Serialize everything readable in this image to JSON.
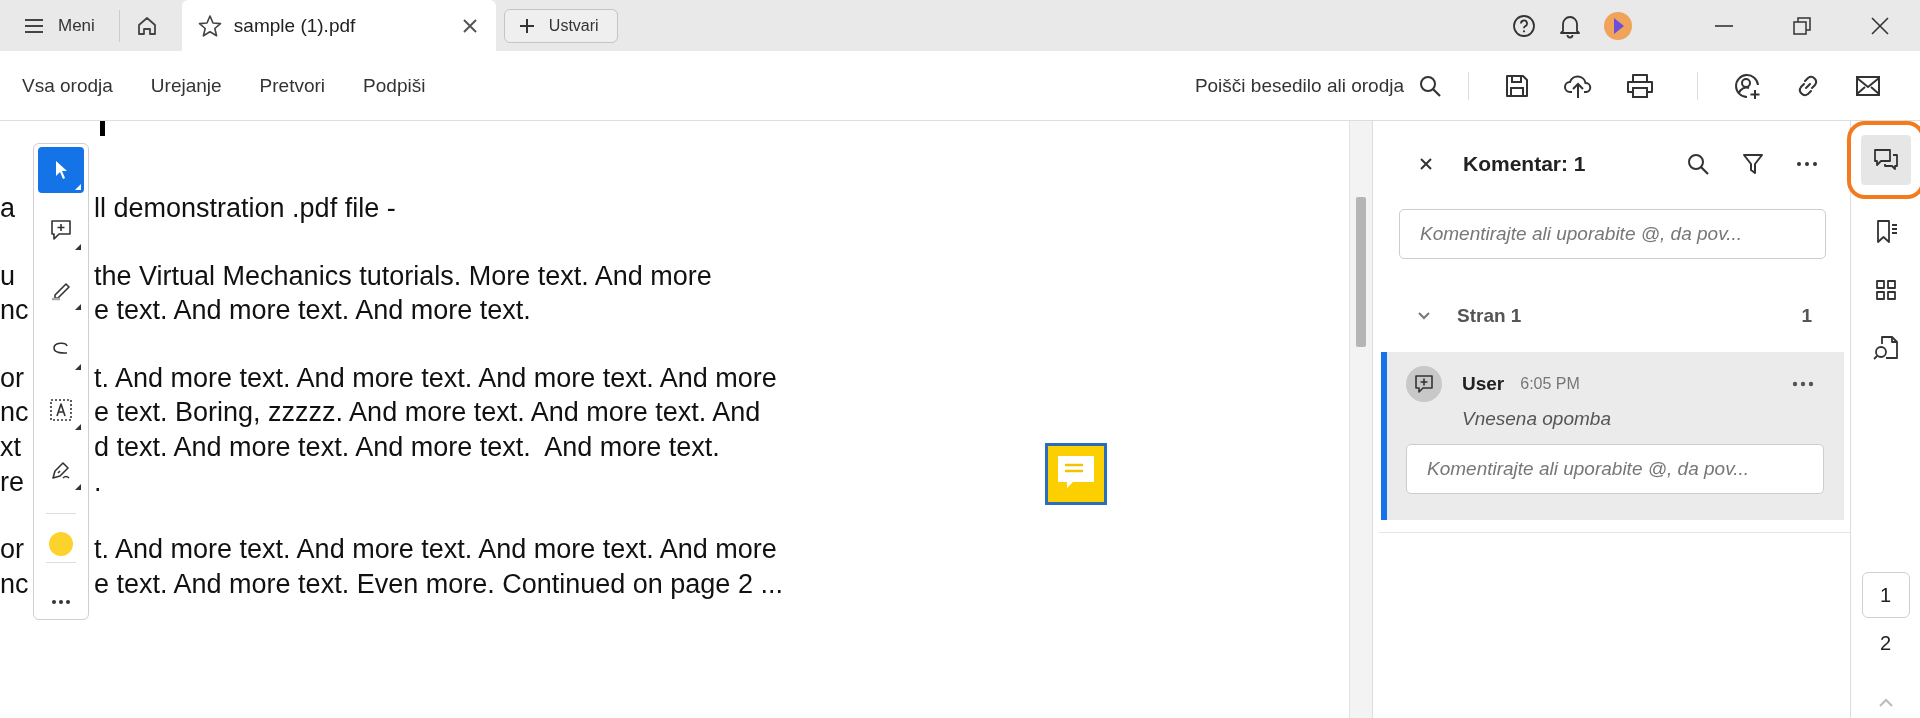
{
  "title_bar": {
    "menu_label": "Meni",
    "tabs": [
      {
        "label": "sample (1).pdf",
        "selected": true
      }
    ],
    "create_button": "Ustvari"
  },
  "menu_bar": {
    "items": [
      {
        "label": "Vsa orodja"
      },
      {
        "label": "Urejanje"
      },
      {
        "label": "Pretvori"
      },
      {
        "label": "Podpiši"
      }
    ],
    "search_label": "Poišči besedilo ali orodja"
  },
  "tool_palette": {
    "tools": [
      {
        "kind": "select",
        "selected": true
      },
      {
        "kind": "comment",
        "selected": false
      },
      {
        "kind": "highlight",
        "selected": false
      },
      {
        "kind": "draw",
        "selected": false
      },
      {
        "kind": "textbox",
        "selected": false
      },
      {
        "kind": "sign",
        "selected": false
      }
    ],
    "color": "#fcd22c"
  },
  "document": {
    "paragraphs": [
      [
        {
          "left": "a",
          "right": "ll demonstration .pdf file -"
        }
      ],
      [
        {
          "left": "u",
          "right": "the Virtual Mechanics tutorials. More text. And more"
        },
        {
          "left": "nc",
          "right": "e text. And more text. And more text."
        }
      ],
      [
        {
          "left": "or",
          "right": "t. And more text. And more text. And more text. And more"
        },
        {
          "left": "nc",
          "right": "e text. Boring, zzzzz. And more text. And more text. And"
        },
        {
          "left": "xt",
          "right": "d text. And more text. And more text.  And more text."
        },
        {
          "left": "re",
          "right": "."
        }
      ],
      [
        {
          "left": "or",
          "right": "t. And more text. And more text. And more text. And more"
        },
        {
          "left": "nc",
          "right": "e text. And more text. Even more. Continued on page 2 ..."
        }
      ]
    ]
  },
  "comments_panel": {
    "title": "Komentar: 1",
    "placeholder": "Komentirajte ali uporabite @, da pov...",
    "groups": [
      {
        "label": "Stran 1",
        "count": "1",
        "expanded": true,
        "comments": [
          {
            "author": "User",
            "time": "6:05 PM",
            "text": "Vnesena opomba",
            "selected": true,
            "reply_placeholder": "Komentirajte ali uporabite @, da pov..."
          }
        ]
      }
    ]
  },
  "side_rail": {
    "items": [
      {
        "kind": "comments",
        "selected": true
      },
      {
        "kind": "bookmarks",
        "selected": false
      },
      {
        "kind": "thumbnails",
        "selected": false
      },
      {
        "kind": "search_doc",
        "selected": false
      }
    ],
    "pages": [
      {
        "label": "1",
        "selected": true
      },
      {
        "label": "2",
        "selected": false
      }
    ]
  }
}
